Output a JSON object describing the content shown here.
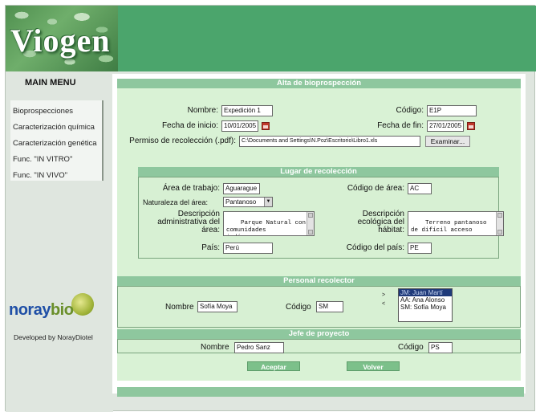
{
  "app": {
    "logo_text": "Viogen",
    "colors": {
      "banner": "#4ba56c",
      "panel_header": "#8ec79e",
      "panel_bg": "#d7f0d3"
    }
  },
  "sidebar": {
    "title": "MAIN MENU",
    "items": [
      {
        "label": "Bioprospecciones"
      },
      {
        "label": "Caracterización química"
      },
      {
        "label": "Caracterización genética"
      },
      {
        "label": "Func. \"IN VITRO\""
      },
      {
        "label": "Func. \"IN VIVO\""
      }
    ],
    "brand_nora": "noray",
    "brand_bio": "bio",
    "developed_by": "Developed by NorayDiotel"
  },
  "form": {
    "title": "Alta de bioprospección",
    "nombre_label": "Nombre:",
    "nombre_value": "Expedición 1",
    "codigo_label": "Código:",
    "codigo_value": "E1P",
    "fecha_inicio_label": "Fecha de inicio:",
    "fecha_inicio_value": "10/01/2005",
    "fecha_fin_label": "Fecha de fin:",
    "fecha_fin_value": "27/01/2005",
    "permiso_label": "Permiso de recolección (.pdf):",
    "permiso_value": "C:\\Documents and Settings\\N.Poz\\Escritorio\\Libro1.xls",
    "examinar_label": "Examinar..."
  },
  "lugar": {
    "title": "Lugar de recolección",
    "area_trabajo_label": "Área de trabajo:",
    "area_trabajo_value": "Aguarague",
    "codigo_area_label": "Código de área:",
    "codigo_area_value": "AC",
    "naturaleza_label": "Naturaleza del área:",
    "naturaleza_value": "Pantanoso",
    "desc_admin_label_1": "Descripción",
    "desc_admin_label_2": "administrativa del",
    "desc_admin_label_3": "área:",
    "desc_admin_value": "Parque Natural con\ncomunidades\nindígenas",
    "desc_eco_label_1": "Descripción",
    "desc_eco_label_2": "ecológica del",
    "desc_eco_label_3": "hábitat:",
    "desc_eco_value": "Terreno pantanoso\nde difícil acceso",
    "pais_label": "País:",
    "pais_value": "Perú",
    "codigo_pais_label": "Código del país:",
    "codigo_pais_value": "PE"
  },
  "personal": {
    "title": "Personal recolector",
    "nombre_label": "Nombre",
    "nombre_value": "Sofía Moya",
    "codigo_label": "Código",
    "codigo_value": "SM",
    "list": [
      {
        "label": "JM: Juan Martí",
        "selected": true
      },
      {
        "label": "AA: Ana Alonso",
        "selected": false
      },
      {
        "label": "SM: Sofía Moya",
        "selected": false
      }
    ],
    "add_arrow": ">",
    "remove_arrow": "<"
  },
  "jefe": {
    "title": "Jefe de proyecto",
    "nombre_label": "Nombre",
    "nombre_value": "Pedro Sanz",
    "codigo_label": "Código",
    "codigo_value": "PS"
  },
  "actions": {
    "aceptar_label": "Aceptar",
    "volver_label": "Volver"
  }
}
